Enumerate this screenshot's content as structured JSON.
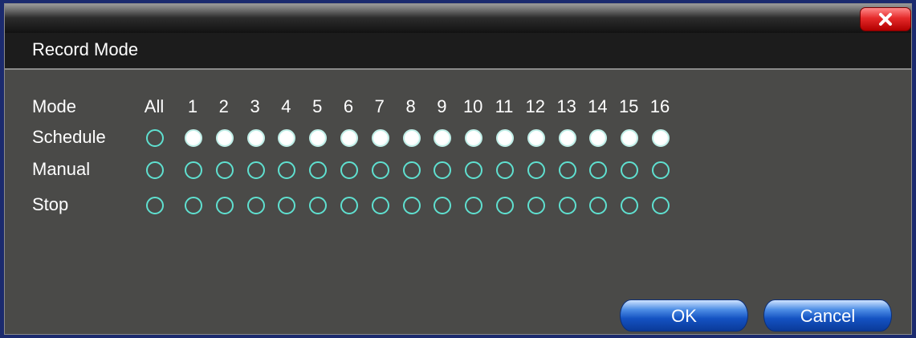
{
  "dialog": {
    "title": "Record Mode",
    "close_icon": "close-icon"
  },
  "grid": {
    "mode_label": "Mode",
    "all_label": "All",
    "channels": [
      "1",
      "2",
      "3",
      "4",
      "5",
      "6",
      "7",
      "8",
      "9",
      "10",
      "11",
      "12",
      "13",
      "14",
      "15",
      "16"
    ],
    "rows": [
      {
        "label": "Schedule",
        "all": false,
        "channels": [
          true,
          true,
          true,
          true,
          true,
          true,
          true,
          true,
          true,
          true,
          true,
          true,
          true,
          true,
          true,
          true
        ]
      },
      {
        "label": "Manual",
        "all": false,
        "channels": [
          false,
          false,
          false,
          false,
          false,
          false,
          false,
          false,
          false,
          false,
          false,
          false,
          false,
          false,
          false,
          false
        ]
      },
      {
        "label": "Stop",
        "all": false,
        "channels": [
          false,
          false,
          false,
          false,
          false,
          false,
          false,
          false,
          false,
          false,
          false,
          false,
          false,
          false,
          false,
          false
        ]
      }
    ]
  },
  "buttons": {
    "ok_label": "OK",
    "cancel_label": "Cancel"
  },
  "colors": {
    "radio_ring": "#5fe0d0",
    "panel_bg": "#4a4a48",
    "header_bg": "#1c1c1c",
    "close_red": "#e52a2a",
    "button_blue": "#1452c2"
  }
}
